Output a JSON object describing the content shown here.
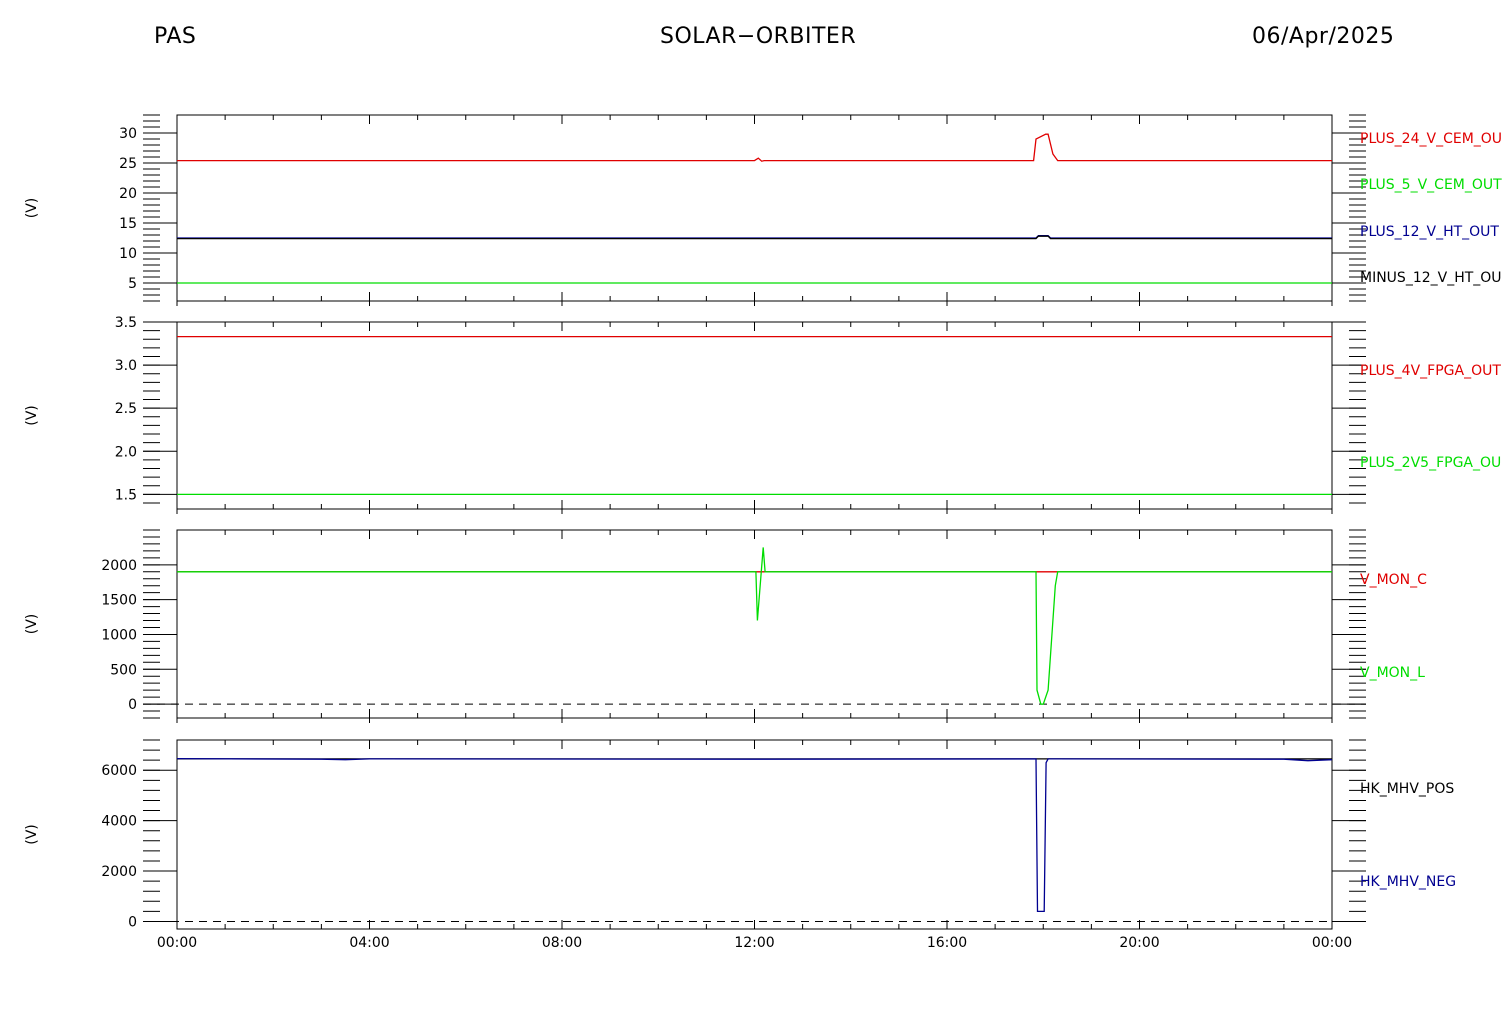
{
  "header": {
    "left": "PAS",
    "center": "SOLAR−ORBITER",
    "right": "06/Apr/2025"
  },
  "colors": {
    "red": "#e00000",
    "green": "#00dd00",
    "blue": "#000090",
    "black": "#000000"
  },
  "chart_data": [
    {
      "type": "line",
      "ylabel": "(V)",
      "ylim": [
        2,
        33
      ],
      "yticks": [
        5,
        10,
        15,
        20,
        25,
        30
      ],
      "ytick_labels": [
        "5",
        "10",
        "15",
        "20",
        "25",
        "30"
      ],
      "xticks_labelled": false,
      "series": [
        {
          "name": "PLUS_24_V_CEM_OU",
          "color": "red",
          "x": [
            0,
            12.0,
            12.08,
            12.15,
            12.2,
            17.8,
            17.85,
            18.05,
            18.1,
            18.2,
            18.3,
            24
          ],
          "y": [
            25.4,
            25.4,
            25.8,
            25.3,
            25.4,
            25.4,
            29,
            29.8,
            29.8,
            26.5,
            25.4,
            25.4
          ]
        },
        {
          "name": "PLUS_5_V_CEM_OUT",
          "color": "green",
          "x": [
            0,
            24
          ],
          "y": [
            5.0,
            5.0
          ]
        },
        {
          "name": "PLUS_12_V_HT_OUT",
          "color": "blue",
          "x": [
            0,
            17.85,
            17.9,
            18.1,
            18.15,
            24
          ],
          "y": [
            12.5,
            12.5,
            12.9,
            12.9,
            12.5,
            12.5
          ]
        },
        {
          "name": "MINUS_12_V_HT_OU",
          "color": "black",
          "x": [
            0,
            17.85,
            17.9,
            18.1,
            18.15,
            24
          ],
          "y": [
            12.4,
            12.4,
            12.8,
            12.8,
            12.4,
            12.4
          ]
        }
      ]
    },
    {
      "type": "line",
      "ylabel": "(V)",
      "ylim": [
        1.33,
        3.5
      ],
      "yticks": [
        1.5,
        2.0,
        2.5,
        3.0,
        3.5
      ],
      "ytick_labels": [
        "1.5",
        "2.0",
        "2.5",
        "3.0",
        "3.5"
      ],
      "xticks_labelled": false,
      "series": [
        {
          "name": "PLUS_4V_FPGA_OUT",
          "color": "red",
          "x": [
            0,
            24
          ],
          "y": [
            3.33,
            3.33
          ]
        },
        {
          "name": "PLUS_2V5_FPGA_OU",
          "color": "green",
          "x": [
            0,
            24
          ],
          "y": [
            1.5,
            1.5
          ]
        }
      ]
    },
    {
      "type": "line",
      "ylabel": "(V)",
      "ylim": [
        -200,
        2500
      ],
      "yticks": [
        0,
        500,
        1000,
        1500,
        2000
      ],
      "ytick_labels": [
        "0",
        "500",
        "1000",
        "1500",
        "2000"
      ],
      "xticks_labelled": false,
      "zero_dashed": true,
      "series": [
        {
          "name": "V_MON_C",
          "color": "red",
          "x": [
            0,
            24
          ],
          "y": [
            1900,
            1900
          ]
        },
        {
          "name": "V_MON_L",
          "color": "green",
          "x": [
            0,
            12.03,
            12.06,
            12.18,
            12.22,
            17.85,
            17.87,
            17.95,
            18.0,
            18.1,
            18.25,
            18.3,
            24
          ],
          "y": [
            1900,
            1900,
            1200,
            2250,
            1900,
            1900,
            200,
            0,
            0,
            200,
            1700,
            1900,
            1900
          ]
        }
      ]
    },
    {
      "type": "line",
      "ylabel": "(V)",
      "ylim": [
        -300,
        7200
      ],
      "yticks": [
        0,
        2000,
        4000,
        6000
      ],
      "ytick_labels": [
        "0",
        "2000",
        "4000",
        "6000"
      ],
      "xticks_labelled": true,
      "x_tick_labels": [
        "00:00",
        "04:00",
        "08:00",
        "12:00",
        "16:00",
        "20:00",
        "00:00"
      ],
      "zero_dashed": true,
      "series": [
        {
          "name": "HK_MHV_POS",
          "color": "black",
          "x": [
            0,
            24
          ],
          "y": [
            6450,
            6450
          ]
        },
        {
          "name": "HK_MHV_NEG",
          "color": "blue",
          "x": [
            0,
            3.0,
            3.5,
            4.0,
            12.0,
            17.85,
            17.88,
            18.02,
            18.06,
            18.1,
            18.2,
            23.0,
            23.5,
            24
          ],
          "y": [
            6460,
            6440,
            6420,
            6450,
            6440,
            6450,
            400,
            400,
            6300,
            6450,
            6450,
            6440,
            6380,
            6420
          ]
        }
      ]
    }
  ]
}
